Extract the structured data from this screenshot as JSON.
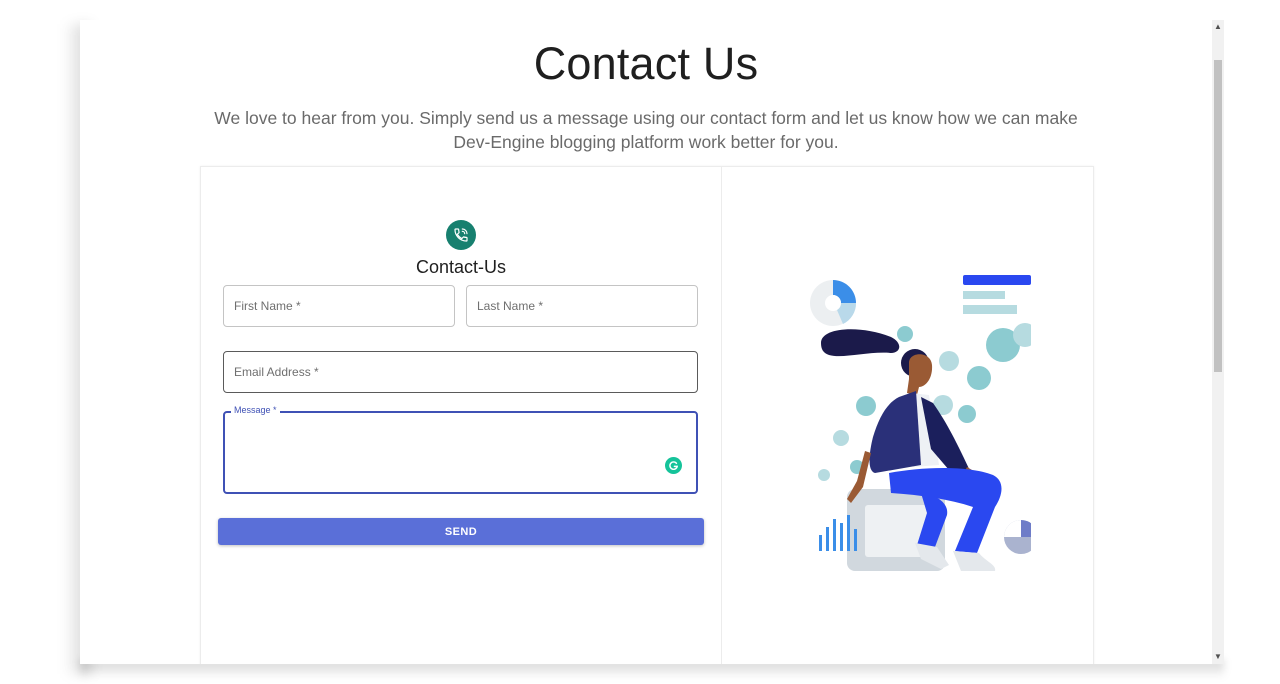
{
  "page": {
    "title": "Contact Us",
    "subtitle": "We love to hear from you. Simply send us a message using our contact form and let us know how we can make Dev-Engine blogging platform work better for you."
  },
  "form": {
    "heading": "Contact-Us",
    "icon": "phone-call-icon",
    "first_name_placeholder": "First Name *",
    "last_name_placeholder": "Last Name *",
    "email_placeholder": "Email Address *",
    "message_label": "Message *",
    "message_value": "",
    "send_label": "SEND"
  },
  "illustration": {
    "name": "contact-illustration"
  },
  "colors": {
    "accent": "#3f51b5",
    "button": "#5a6fd8",
    "icon_bg": "#17806f"
  }
}
